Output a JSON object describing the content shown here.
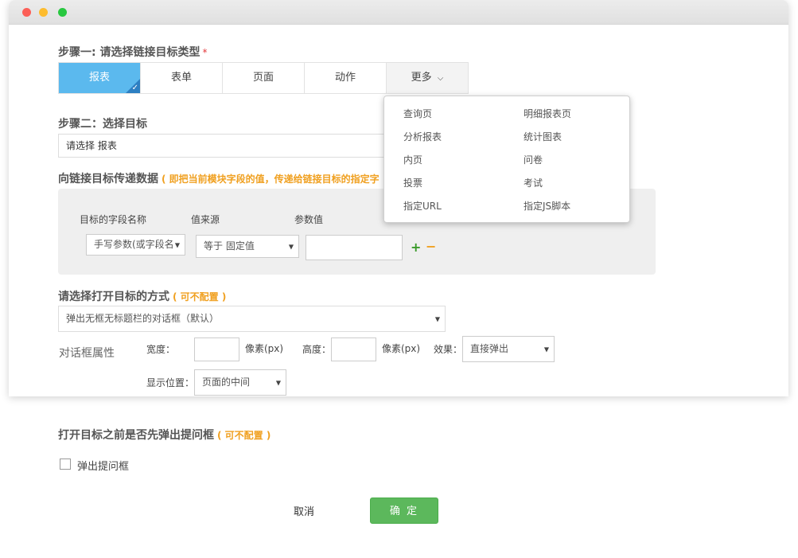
{
  "step1": {
    "title": "步骤一: 请选择链接目标类型",
    "required": "*"
  },
  "tabs": [
    {
      "label": "报表"
    },
    {
      "label": "表单"
    },
    {
      "label": "页面"
    },
    {
      "label": "动作"
    },
    {
      "label": "更多"
    }
  ],
  "more_menu": {
    "items": [
      "查询页",
      "明细报表页",
      "分析报表",
      "统计图表",
      "内页",
      "问卷",
      "投票",
      "考试",
      "指定URL",
      "指定JS脚本"
    ]
  },
  "step2": {
    "title": "步骤二：选择目标",
    "value": "请选择 报表"
  },
  "pass_data": {
    "title": "向链接目标传递数据",
    "hint": "( 即把当前模块字段的值，传递给链接目标的指定字",
    "col_field": "目标的字段名称",
    "col_source": "值来源",
    "col_value": "参数值",
    "field_select": "手写参数(或字段名",
    "source_select": "等于 固定值",
    "value_input": "",
    "add": "+",
    "remove": "−"
  },
  "open_mode": {
    "title": "请选择打开目标的方式",
    "hint": "( 可不配置 )",
    "selected": "弹出无框无标题栏的对话框（默认）"
  },
  "dialog_props": {
    "label": "对话框属性",
    "width_label": "宽度：",
    "width_value": "",
    "width_unit": "像素(px)",
    "height_label": "高度：",
    "height_value": "",
    "height_unit": "像素(px)",
    "effect_label": "效果：",
    "effect_value": "直接弹出",
    "position_label": "显示位置：",
    "position_value": "页面的中间"
  },
  "confirm_prompt": {
    "title": "打开目标之前是否先弹出提问框",
    "hint": "( 可不配置 )",
    "checkbox_label": "弹出提问框",
    "checked": false
  },
  "buttons": {
    "cancel": "取消",
    "ok": "确 定"
  },
  "colors": {
    "tab_active": "#5bb9ee",
    "ok_button": "#5cb85c",
    "hint": "#f0a020",
    "add": "#3a9a2a",
    "remove": "#f0a020"
  }
}
